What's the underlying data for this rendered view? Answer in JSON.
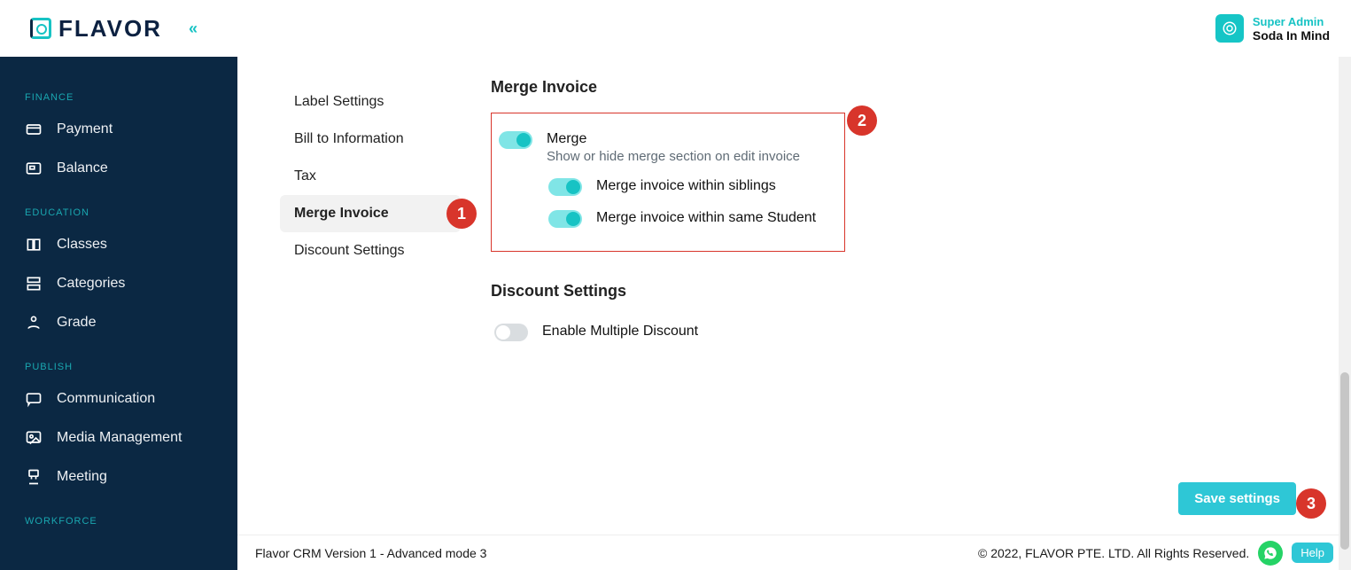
{
  "brand": {
    "name": "FLAVOR"
  },
  "header": {
    "user_role": "Super Admin",
    "user_name": "Soda In Mind"
  },
  "sidebar": {
    "sections": [
      {
        "label": "FINANCE",
        "items": [
          {
            "label": "Payment",
            "icon": "card"
          },
          {
            "label": "Balance",
            "icon": "wallet"
          }
        ]
      },
      {
        "label": "EDUCATION",
        "items": [
          {
            "label": "Classes",
            "icon": "book"
          },
          {
            "label": "Categories",
            "icon": "folder"
          },
          {
            "label": "Grade",
            "icon": "grade"
          }
        ]
      },
      {
        "label": "PUBLISH",
        "items": [
          {
            "label": "Communication",
            "icon": "chat"
          },
          {
            "label": "Media Management",
            "icon": "media"
          },
          {
            "label": "Meeting",
            "icon": "meeting"
          }
        ]
      },
      {
        "label": "WORKFORCE",
        "items": []
      }
    ]
  },
  "subnav": {
    "items": [
      {
        "label": "Label Settings"
      },
      {
        "label": "Bill to Information"
      },
      {
        "label": "Tax"
      },
      {
        "label": "Merge Invoice",
        "active": true
      },
      {
        "label": "Discount Settings"
      }
    ]
  },
  "merge_invoice": {
    "title": "Merge Invoice",
    "merge_label": "Merge",
    "merge_desc": "Show or hide merge section on edit invoice",
    "siblings_label": "Merge invoice within siblings",
    "same_student_label": "Merge invoice within same Student",
    "merge_on": true,
    "siblings_on": true,
    "same_student_on": true
  },
  "discount_settings": {
    "title": "Discount Settings",
    "enable_label": "Enable Multiple Discount",
    "enable_on": false
  },
  "actions": {
    "save_label": "Save settings"
  },
  "footer": {
    "version": "Flavor CRM Version 1 - Advanced mode 3",
    "copyright": "© 2022, FLAVOR PTE. LTD. All Rights Reserved.",
    "help_label": "Help"
  },
  "annotations": {
    "badge1": "1",
    "badge2": "2",
    "badge3": "3"
  }
}
